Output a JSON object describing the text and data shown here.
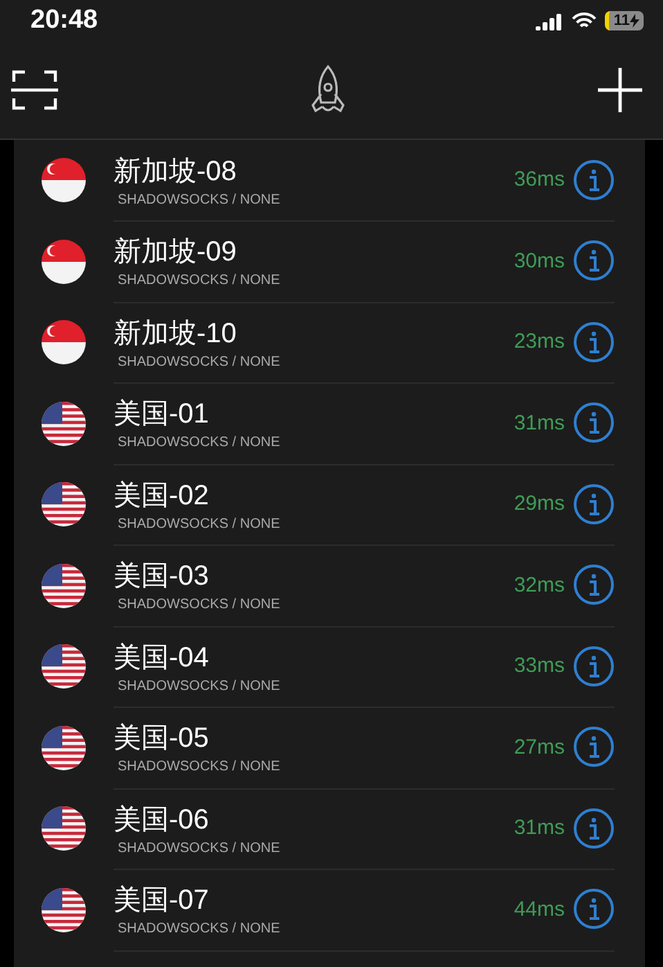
{
  "status_bar": {
    "time": "20:48",
    "battery": "11"
  },
  "servers": [
    {
      "name": "新加坡-08",
      "protocol": "SHADOWSOCKS / NONE",
      "latency": "36ms",
      "kind": "sg"
    },
    {
      "name": "新加坡-09",
      "protocol": "SHADOWSOCKS / NONE",
      "latency": "30ms",
      "kind": "sg"
    },
    {
      "name": "新加坡-10",
      "protocol": "SHADOWSOCKS / NONE",
      "latency": "23ms",
      "kind": "sg"
    },
    {
      "name": "美国-01",
      "protocol": "SHADOWSOCKS / NONE",
      "latency": "31ms",
      "kind": "us"
    },
    {
      "name": "美国-02",
      "protocol": "SHADOWSOCKS / NONE",
      "latency": "29ms",
      "kind": "us"
    },
    {
      "name": "美国-03",
      "protocol": "SHADOWSOCKS / NONE",
      "latency": "32ms",
      "kind": "us"
    },
    {
      "name": "美国-04",
      "protocol": "SHADOWSOCKS / NONE",
      "latency": "33ms",
      "kind": "us"
    },
    {
      "name": "美国-05",
      "protocol": "SHADOWSOCKS / NONE",
      "latency": "27ms",
      "kind": "us"
    },
    {
      "name": "美国-06",
      "protocol": "SHADOWSOCKS / NONE",
      "latency": "31ms",
      "kind": "us"
    },
    {
      "name": "美国-07",
      "protocol": "SHADOWSOCKS / NONE",
      "latency": "44ms",
      "kind": "us"
    }
  ]
}
